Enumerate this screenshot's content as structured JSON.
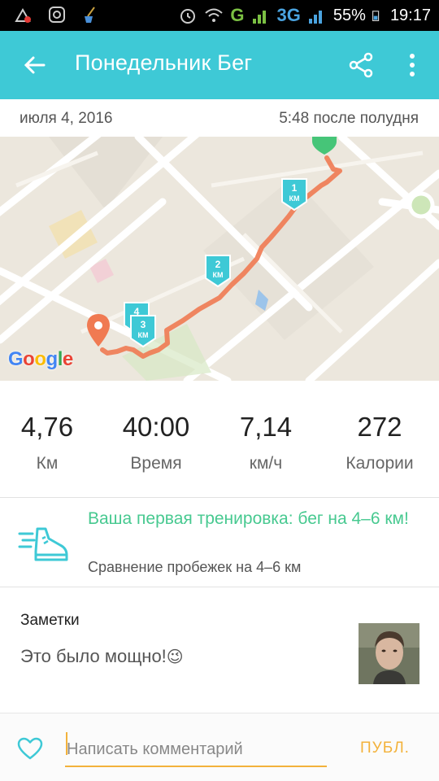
{
  "status_bar": {
    "battery": "55%",
    "time": "19:17",
    "network_g": "G",
    "network_3g": "3G"
  },
  "app_bar": {
    "title": "Понедельник Бег"
  },
  "activity": {
    "date": "июля 4, 2016",
    "time": "5:48 после полудня"
  },
  "map": {
    "google_logo": "Google",
    "km_markers": [
      {
        "num": "1",
        "unit": "КМ"
      },
      {
        "num": "2",
        "unit": "КМ"
      },
      {
        "num": "3",
        "unit": "КМ"
      },
      {
        "num": "4",
        "unit": ""
      }
    ]
  },
  "stats": [
    {
      "value": "4,76",
      "label": "Км"
    },
    {
      "value": "40:00",
      "label": "Время"
    },
    {
      "value": "7,14",
      "label": "км/ч"
    },
    {
      "value": "272",
      "label": "Калории"
    }
  ],
  "achievement": {
    "headline": "Ваша первая тренировка: бег на 4–6 км!",
    "subtitle": "Сравнение пробежек на 4–6 км"
  },
  "notes": {
    "label": "Заметки",
    "text": "Это было мощно!",
    "emoji": "😉"
  },
  "comment": {
    "placeholder": "Написать комментарий",
    "post_label": "ПУБЛ."
  },
  "colors": {
    "accent": "#3ec9d6",
    "route": "#f07a52",
    "achievement": "#47c990",
    "post": "#f3b23b"
  }
}
